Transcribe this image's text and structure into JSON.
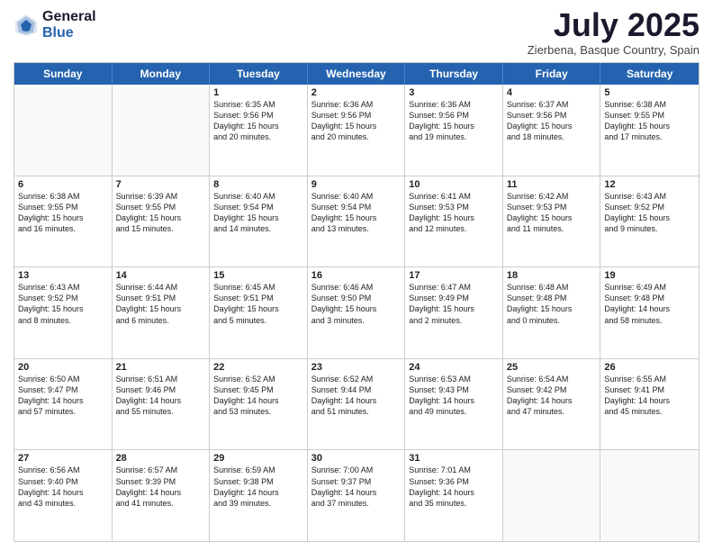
{
  "header": {
    "logo_general": "General",
    "logo_blue": "Blue",
    "month_title": "July 2025",
    "location": "Zierbena, Basque Country, Spain"
  },
  "weekdays": [
    "Sunday",
    "Monday",
    "Tuesday",
    "Wednesday",
    "Thursday",
    "Friday",
    "Saturday"
  ],
  "weeks": [
    [
      {
        "day": "",
        "lines": [],
        "empty": true
      },
      {
        "day": "",
        "lines": [],
        "empty": true
      },
      {
        "day": "1",
        "lines": [
          "Sunrise: 6:35 AM",
          "Sunset: 9:56 PM",
          "Daylight: 15 hours",
          "and 20 minutes."
        ],
        "empty": false
      },
      {
        "day": "2",
        "lines": [
          "Sunrise: 6:36 AM",
          "Sunset: 9:56 PM",
          "Daylight: 15 hours",
          "and 20 minutes."
        ],
        "empty": false
      },
      {
        "day": "3",
        "lines": [
          "Sunrise: 6:36 AM",
          "Sunset: 9:56 PM",
          "Daylight: 15 hours",
          "and 19 minutes."
        ],
        "empty": false
      },
      {
        "day": "4",
        "lines": [
          "Sunrise: 6:37 AM",
          "Sunset: 9:56 PM",
          "Daylight: 15 hours",
          "and 18 minutes."
        ],
        "empty": false
      },
      {
        "day": "5",
        "lines": [
          "Sunrise: 6:38 AM",
          "Sunset: 9:55 PM",
          "Daylight: 15 hours",
          "and 17 minutes."
        ],
        "empty": false
      }
    ],
    [
      {
        "day": "6",
        "lines": [
          "Sunrise: 6:38 AM",
          "Sunset: 9:55 PM",
          "Daylight: 15 hours",
          "and 16 minutes."
        ],
        "empty": false
      },
      {
        "day": "7",
        "lines": [
          "Sunrise: 6:39 AM",
          "Sunset: 9:55 PM",
          "Daylight: 15 hours",
          "and 15 minutes."
        ],
        "empty": false
      },
      {
        "day": "8",
        "lines": [
          "Sunrise: 6:40 AM",
          "Sunset: 9:54 PM",
          "Daylight: 15 hours",
          "and 14 minutes."
        ],
        "empty": false
      },
      {
        "day": "9",
        "lines": [
          "Sunrise: 6:40 AM",
          "Sunset: 9:54 PM",
          "Daylight: 15 hours",
          "and 13 minutes."
        ],
        "empty": false
      },
      {
        "day": "10",
        "lines": [
          "Sunrise: 6:41 AM",
          "Sunset: 9:53 PM",
          "Daylight: 15 hours",
          "and 12 minutes."
        ],
        "empty": false
      },
      {
        "day": "11",
        "lines": [
          "Sunrise: 6:42 AM",
          "Sunset: 9:53 PM",
          "Daylight: 15 hours",
          "and 11 minutes."
        ],
        "empty": false
      },
      {
        "day": "12",
        "lines": [
          "Sunrise: 6:43 AM",
          "Sunset: 9:52 PM",
          "Daylight: 15 hours",
          "and 9 minutes."
        ],
        "empty": false
      }
    ],
    [
      {
        "day": "13",
        "lines": [
          "Sunrise: 6:43 AM",
          "Sunset: 9:52 PM",
          "Daylight: 15 hours",
          "and 8 minutes."
        ],
        "empty": false
      },
      {
        "day": "14",
        "lines": [
          "Sunrise: 6:44 AM",
          "Sunset: 9:51 PM",
          "Daylight: 15 hours",
          "and 6 minutes."
        ],
        "empty": false
      },
      {
        "day": "15",
        "lines": [
          "Sunrise: 6:45 AM",
          "Sunset: 9:51 PM",
          "Daylight: 15 hours",
          "and 5 minutes."
        ],
        "empty": false
      },
      {
        "day": "16",
        "lines": [
          "Sunrise: 6:46 AM",
          "Sunset: 9:50 PM",
          "Daylight: 15 hours",
          "and 3 minutes."
        ],
        "empty": false
      },
      {
        "day": "17",
        "lines": [
          "Sunrise: 6:47 AM",
          "Sunset: 9:49 PM",
          "Daylight: 15 hours",
          "and 2 minutes."
        ],
        "empty": false
      },
      {
        "day": "18",
        "lines": [
          "Sunrise: 6:48 AM",
          "Sunset: 9:48 PM",
          "Daylight: 15 hours",
          "and 0 minutes."
        ],
        "empty": false
      },
      {
        "day": "19",
        "lines": [
          "Sunrise: 6:49 AM",
          "Sunset: 9:48 PM",
          "Daylight: 14 hours",
          "and 58 minutes."
        ],
        "empty": false
      }
    ],
    [
      {
        "day": "20",
        "lines": [
          "Sunrise: 6:50 AM",
          "Sunset: 9:47 PM",
          "Daylight: 14 hours",
          "and 57 minutes."
        ],
        "empty": false
      },
      {
        "day": "21",
        "lines": [
          "Sunrise: 6:51 AM",
          "Sunset: 9:46 PM",
          "Daylight: 14 hours",
          "and 55 minutes."
        ],
        "empty": false
      },
      {
        "day": "22",
        "lines": [
          "Sunrise: 6:52 AM",
          "Sunset: 9:45 PM",
          "Daylight: 14 hours",
          "and 53 minutes."
        ],
        "empty": false
      },
      {
        "day": "23",
        "lines": [
          "Sunrise: 6:52 AM",
          "Sunset: 9:44 PM",
          "Daylight: 14 hours",
          "and 51 minutes."
        ],
        "empty": false
      },
      {
        "day": "24",
        "lines": [
          "Sunrise: 6:53 AM",
          "Sunset: 9:43 PM",
          "Daylight: 14 hours",
          "and 49 minutes."
        ],
        "empty": false
      },
      {
        "day": "25",
        "lines": [
          "Sunrise: 6:54 AM",
          "Sunset: 9:42 PM",
          "Daylight: 14 hours",
          "and 47 minutes."
        ],
        "empty": false
      },
      {
        "day": "26",
        "lines": [
          "Sunrise: 6:55 AM",
          "Sunset: 9:41 PM",
          "Daylight: 14 hours",
          "and 45 minutes."
        ],
        "empty": false
      }
    ],
    [
      {
        "day": "27",
        "lines": [
          "Sunrise: 6:56 AM",
          "Sunset: 9:40 PM",
          "Daylight: 14 hours",
          "and 43 minutes."
        ],
        "empty": false
      },
      {
        "day": "28",
        "lines": [
          "Sunrise: 6:57 AM",
          "Sunset: 9:39 PM",
          "Daylight: 14 hours",
          "and 41 minutes."
        ],
        "empty": false
      },
      {
        "day": "29",
        "lines": [
          "Sunrise: 6:59 AM",
          "Sunset: 9:38 PM",
          "Daylight: 14 hours",
          "and 39 minutes."
        ],
        "empty": false
      },
      {
        "day": "30",
        "lines": [
          "Sunrise: 7:00 AM",
          "Sunset: 9:37 PM",
          "Daylight: 14 hours",
          "and 37 minutes."
        ],
        "empty": false
      },
      {
        "day": "31",
        "lines": [
          "Sunrise: 7:01 AM",
          "Sunset: 9:36 PM",
          "Daylight: 14 hours",
          "and 35 minutes."
        ],
        "empty": false
      },
      {
        "day": "",
        "lines": [],
        "empty": true
      },
      {
        "day": "",
        "lines": [],
        "empty": true
      }
    ]
  ]
}
